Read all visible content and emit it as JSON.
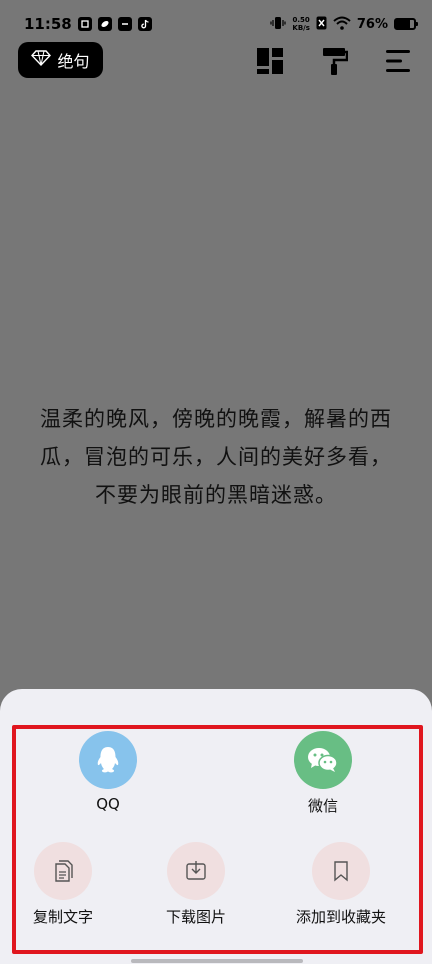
{
  "status_bar": {
    "time": "11:58",
    "net_speed_value": "0.50",
    "net_speed_unit": "KB/s",
    "battery_percent": "76%",
    "battery_level": 0.76
  },
  "header": {
    "badge_label": "绝句"
  },
  "quote": {
    "text": "温柔的晚风，傍晚的晚霞，解暑的西瓜，冒泡的可乐，人间的美好多看，不要为眼前的黑暗迷惑。"
  },
  "share_sheet": {
    "qq_label": "QQ",
    "wechat_label": "微信",
    "copy_text_label": "复制文字",
    "download_image_label": "下载图片",
    "add_favorite_label": "添加到收藏夹"
  },
  "colors": {
    "background": "#777777",
    "sheet": "#efeff4",
    "qq": "#87c3ec",
    "wechat": "#68be84",
    "action": "#f0dfe0",
    "highlight": "#e0161e"
  }
}
